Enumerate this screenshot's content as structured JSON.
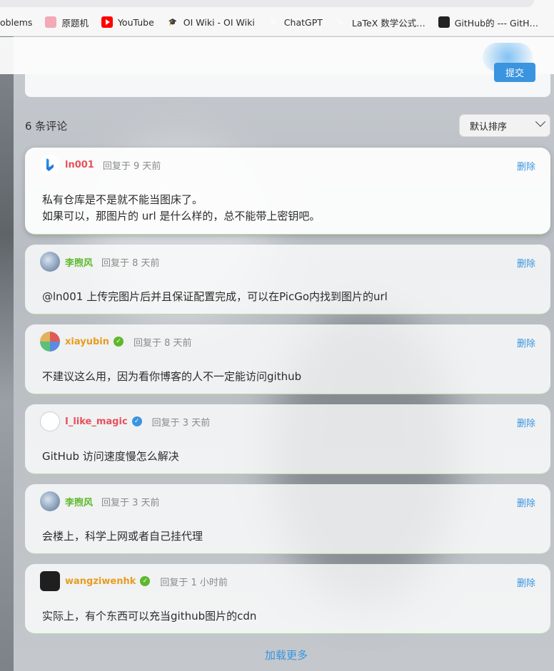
{
  "bookmarks": [
    {
      "label": "oblems",
      "icon": "none"
    },
    {
      "label": "原题机",
      "icon": "pink-circle-icon"
    },
    {
      "label": "YouTube",
      "icon": "youtube-icon"
    },
    {
      "label": "OI Wiki - OI Wiki",
      "icon": "oi-wiki-icon"
    },
    {
      "label": "ChatGPT",
      "icon": "chatgpt-icon"
    },
    {
      "label": "LaTeX 数学公式…",
      "icon": "latex-icon"
    },
    {
      "label": "GitHub的 --- GitH…",
      "icon": "github-icon"
    }
  ],
  "submit_label": "提交",
  "comment_count": "6 条评论",
  "sort": {
    "selected": "默认排序"
  },
  "comments": [
    {
      "user": "ln001",
      "time": "回复于 9 天前",
      "delete": "删除",
      "lines": [
        "私有仓库是不是就不能当图床了。",
        "如果可以，那图片的 url 是什么样的，总不能带上密钥吧。"
      ]
    },
    {
      "user": "李煦风",
      "time": "回复于 8 天前",
      "delete": "删除",
      "lines": [
        "@ln001 上传完图片后并且保证配置完成，可以在PicGo内找到图片的url"
      ]
    },
    {
      "user": "xiayubin",
      "time": "回复于 8 天前",
      "delete": "删除",
      "lines": [
        "不建议这么用，因为看你博客的人不一定能访问github"
      ]
    },
    {
      "user": "I_like_magic",
      "time": "回复于 3 天前",
      "delete": "删除",
      "lines": [
        "GitHub 访问速度慢怎么解决"
      ]
    },
    {
      "user": "李煦风",
      "time": "回复于 3 天前",
      "delete": "删除",
      "lines": [
        "会楼上，科学上网或者自己挂代理"
      ]
    },
    {
      "user": "wangziwenhk",
      "time": "回复于 1 小时前",
      "delete": "删除",
      "lines": [
        "实际上，有个东西可以充当github图片的cdn"
      ]
    }
  ],
  "load_more": "加载更多",
  "colors": {
    "accent": "#3a94df",
    "name_red": "#e8505b",
    "name_green": "#5cb82c",
    "name_orange": "#e79c1f"
  }
}
